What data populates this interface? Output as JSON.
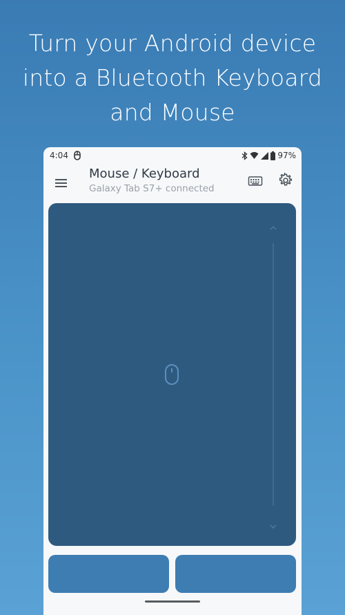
{
  "headline": {
    "line1": "Turn your Android device",
    "line2": "into a Bluetooth Keyboard",
    "line3": "and Mouse"
  },
  "statusbar": {
    "time": "4:04",
    "battery": "97%",
    "icons": [
      "mouse-icon",
      "bluetooth-icon",
      "wifi-icon",
      "signal-icon",
      "battery-icon"
    ]
  },
  "appbar": {
    "title": "Mouse / Keyboard",
    "subtitle": "Galaxy Tab S7+ connected",
    "icons": [
      "hamburger-menu-icon",
      "keyboard-icon",
      "gear-icon"
    ]
  },
  "touchpad": {
    "icons": [
      "mouse-icon",
      "chevron-up-icon",
      "chevron-down-icon"
    ]
  },
  "colors": {
    "background_top": "#3a7bb4",
    "background_bottom": "#5aa2d5",
    "touchpad": "#2f5a80",
    "click_buttons": "#3d7db2",
    "card": "#f7f8fa"
  }
}
